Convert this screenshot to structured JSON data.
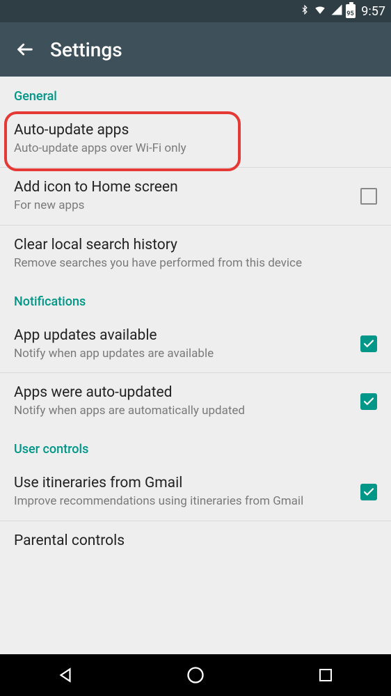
{
  "statusbar": {
    "time": "9:57",
    "battery_pct": "95"
  },
  "appbar": {
    "title": "Settings"
  },
  "sections": {
    "general": {
      "header": "General",
      "auto_update": {
        "title": "Auto-update apps",
        "sub": "Auto-update apps over Wi-Fi only"
      },
      "add_icon": {
        "title": "Add icon to Home screen",
        "sub": "For new apps",
        "checked": false
      },
      "clear_search": {
        "title": "Clear local search history",
        "sub": "Remove searches you have performed from this device"
      }
    },
    "notifications": {
      "header": "Notifications",
      "app_updates": {
        "title": "App updates available",
        "sub": "Notify when app updates are available",
        "checked": true
      },
      "apps_auto": {
        "title": "Apps were auto-updated",
        "sub": "Notify when apps are automatically updated",
        "checked": true
      }
    },
    "user_controls": {
      "header": "User controls",
      "gmail_itin": {
        "title": "Use itineraries from Gmail",
        "sub": "Improve recommendations using itineraries from Gmail",
        "checked": true
      },
      "parental": {
        "title": "Parental controls"
      }
    }
  },
  "colors": {
    "accent": "#009688",
    "appbar": "#3e5059",
    "statusbar": "#2f3e44",
    "highlight": "#e53935"
  }
}
